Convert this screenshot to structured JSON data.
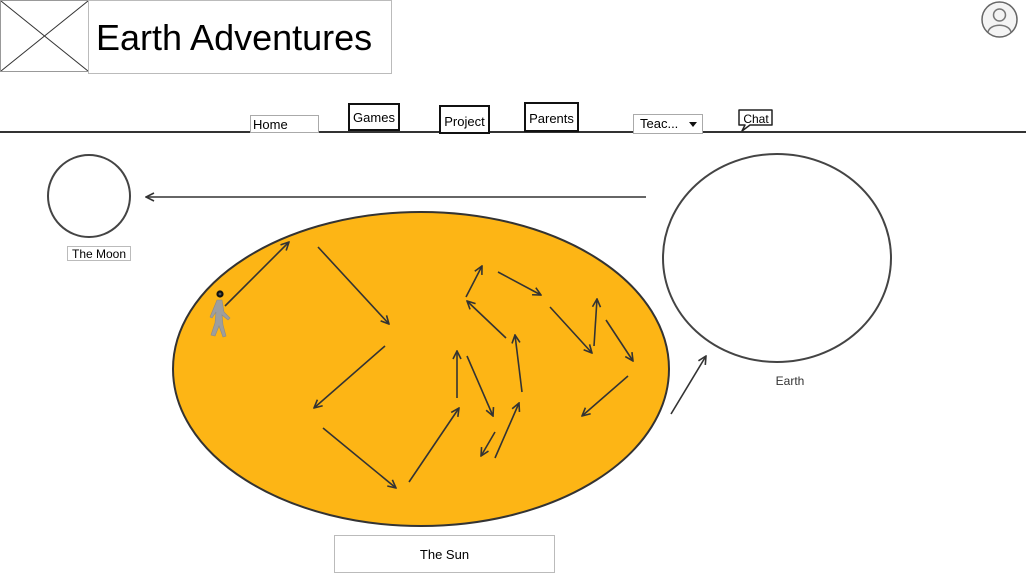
{
  "header": {
    "logo_placeholder": "logo",
    "title": "Earth Adventures",
    "avatar_icon": "user-avatar-icon"
  },
  "nav": {
    "items": [
      {
        "label": "Home"
      },
      {
        "label": "Games"
      },
      {
        "label": "Project"
      },
      {
        "label": "Parents"
      },
      {
        "label": "Teac..."
      },
      {
        "label": "Chat"
      }
    ]
  },
  "scene": {
    "moon_label": "The Moon",
    "earth_label": "Earth",
    "sun_label": "The Sun",
    "sun_color": "#FDB515",
    "stroke_color": "#333333",
    "walker_icon": "walking-person-icon"
  }
}
